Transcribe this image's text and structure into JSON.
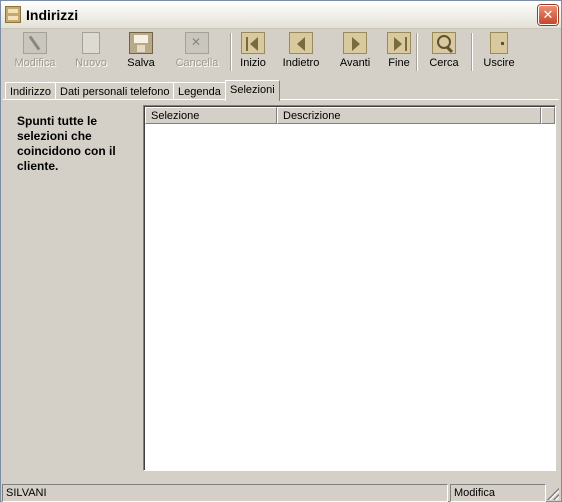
{
  "window": {
    "title": "Indirizzi"
  },
  "toolbar": {
    "modifica": "Modifica",
    "nuovo": "Nuovo",
    "salva": "Salva",
    "cancella": "Cancella",
    "inizio": "Inizio",
    "indietro": "Indietro",
    "avanti": "Avanti",
    "fine": "Fine",
    "cerca": "Cerca",
    "uscire": "Uscire"
  },
  "tabs": [
    "Indirizzo",
    "Dati personali telefono",
    "Legenda",
    "Selezioni"
  ],
  "active_tab": "Selezioni",
  "panel": {
    "hint": "Spunti tutte le selezioni che coincidono con il cliente."
  },
  "list": {
    "columns": [
      "Selezione",
      "Descrizione"
    ],
    "rows": []
  },
  "status": {
    "left": "SILVANI",
    "right": "Modifica"
  },
  "icons": {
    "app": "address-book-icon",
    "close": "close-icon"
  },
  "colors": {
    "close_button": "#c8462c",
    "window_bg": "#d4d0c8"
  }
}
